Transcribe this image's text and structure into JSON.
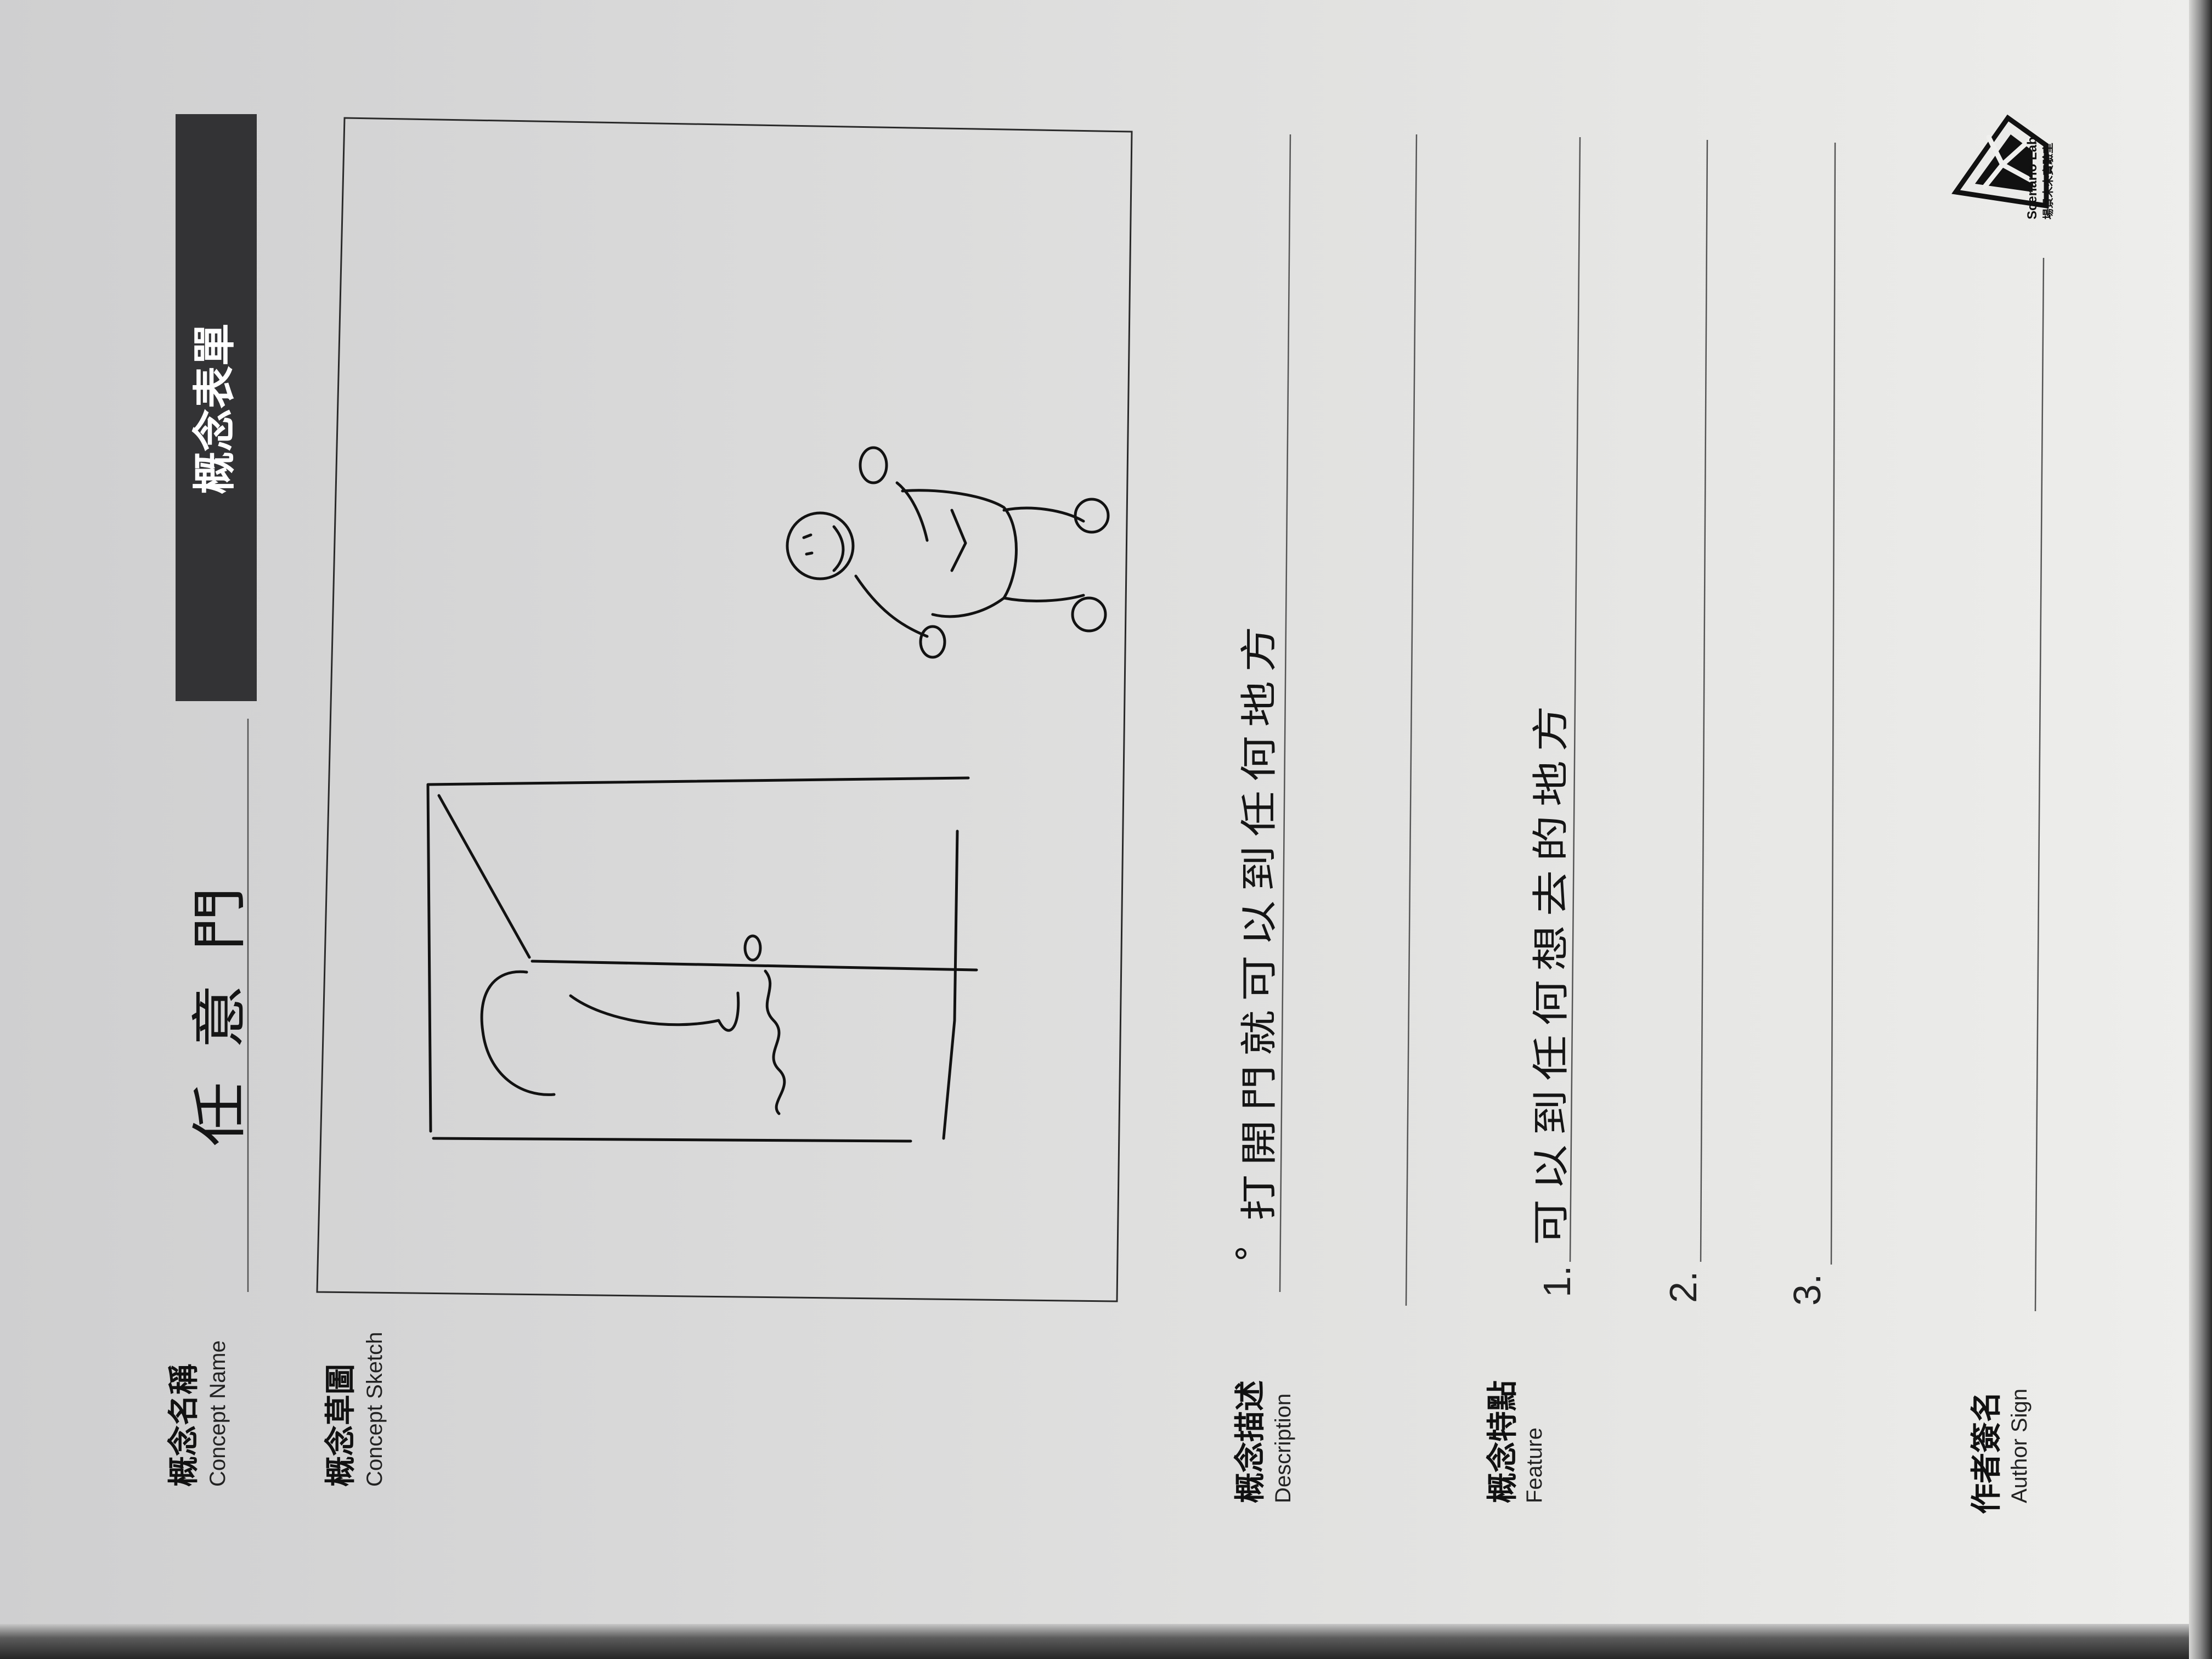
{
  "form": {
    "title": "概念表單",
    "concept_name": {
      "label": "概念名稱",
      "sublabel": "Concept Name",
      "value": "任意門"
    },
    "concept_sketch": {
      "label": "概念草圖",
      "sublabel": "Concept Sketch"
    },
    "description": {
      "label": "概念描述",
      "sublabel": "Description",
      "value": "打開門就可以到任何地方"
    },
    "feature": {
      "label": "概念特點",
      "sublabel": "Feature",
      "items": [
        {
          "number": "1.",
          "value": "可以到任何想去的地方"
        },
        {
          "number": "2.",
          "value": ""
        },
        {
          "number": "3.",
          "value": ""
        }
      ]
    },
    "author": {
      "label": "作者簽名",
      "sublabel": "Author Sign"
    }
  },
  "logo": {
    "line1": "Scenario Lab",
    "line2": "場景未來實驗室"
  },
  "colors": {
    "title_bar": "#333335",
    "title_text": "#ffffff",
    "ink": "#121212"
  }
}
